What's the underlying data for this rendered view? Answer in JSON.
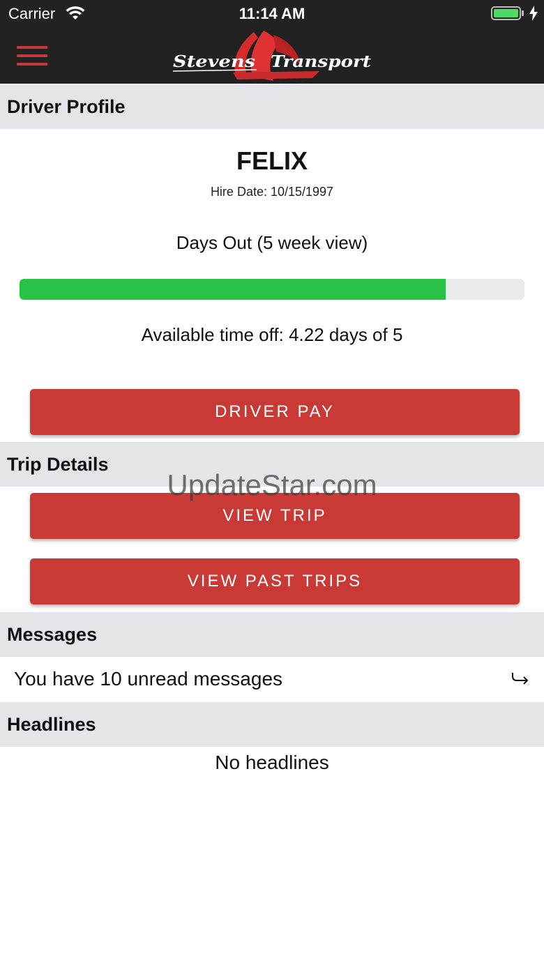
{
  "status_bar": {
    "carrier": "Carrier",
    "time": "11:14 AM",
    "wifi_icon": "wifi-icon",
    "battery_icon": "battery-charging-icon"
  },
  "navbar": {
    "menu_icon": "hamburger-menu-icon",
    "logo_text_left": "Stevens",
    "logo_text_right": "Transport",
    "accent_color": "#c8373a"
  },
  "driver_profile": {
    "header": "Driver Profile",
    "name": "FELIX",
    "hire_date": "Hire Date: 10/15/1997",
    "days_out_label": "Days Out (5 week view)",
    "days_out_progress": 0.844,
    "available_time_off": "Available time off: 4.22 days of 5",
    "driver_pay_button": "DRIVER PAY"
  },
  "trip_details": {
    "header": "Trip Details",
    "view_trip_button": "VIEW TRIP",
    "view_past_trips_button": "VIEW PAST TRIPS"
  },
  "messages": {
    "header": "Messages",
    "unread_text": "You have 10 unread messages",
    "arrow_icon": "return-arrow-icon"
  },
  "headlines": {
    "header": "Headlines",
    "empty_text": "No headlines"
  },
  "watermark": "UpdateStar.com",
  "colors": {
    "button": "#c93a36",
    "progress": "#27c246",
    "section_header_bg": "#e4e5e8",
    "topbar_bg": "#222222"
  }
}
